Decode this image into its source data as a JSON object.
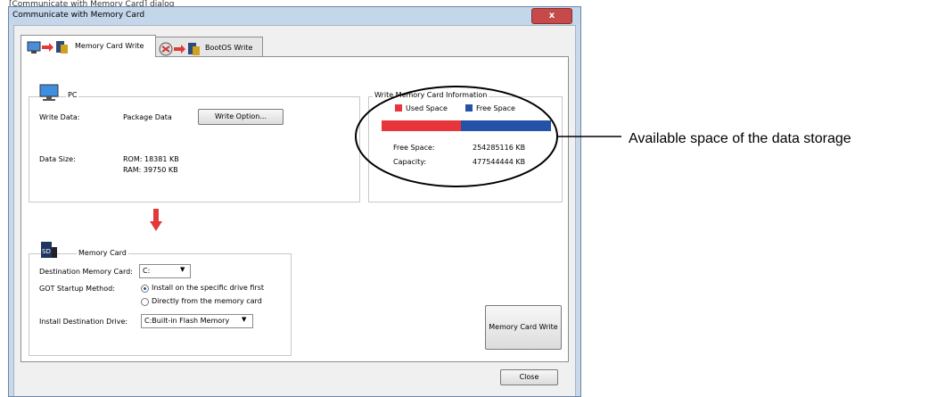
{
  "caption": "[Communicate with Memory Card] dialog",
  "window": {
    "title": "Communicate with Memory Card",
    "close_glyph": "x"
  },
  "tabs": [
    {
      "label": "Memory Card Write",
      "active": true
    },
    {
      "label": "BootOS Write",
      "active": false
    }
  ],
  "pc": {
    "legend": "PC",
    "write_data_label": "Write Data:",
    "write_data_value": "Package Data",
    "write_option_button": "Write Option...",
    "data_size_label": "Data Size:",
    "rom": "ROM: 18381 KB",
    "ram": "RAM: 39750 KB"
  },
  "info": {
    "legend": "Write Memory Card Information",
    "used_legend": "Used Space",
    "free_legend": "Free Space",
    "used_color": "#e8353c",
    "free_color": "#2452a8",
    "used_fraction": 0.4676,
    "free_space_label": "Free Space:",
    "free_space_value": "254285116 KB",
    "capacity_label": "Capacity:",
    "capacity_value": "477544444 KB"
  },
  "memory_card": {
    "legend": "Memory Card",
    "destination_label": "Destination Memory Card:",
    "destination_value": "C:",
    "startup_label": "GOT Startup Method:",
    "startup_options": [
      "Install on the specific drive first",
      "Directly from the memory card"
    ],
    "startup_selected": 0,
    "install_label": "Install Destination Drive:",
    "install_value": "C:Built-in Flash Memory"
  },
  "buttons": {
    "write": "Memory Card Write",
    "close": "Close"
  },
  "annotation": "Available space of the data storage",
  "icons": [
    "pc-icon",
    "arrow-right-icon",
    "memory-card-icon",
    "bootos-icon",
    "down-arrow-icon",
    "sd-card-icon",
    "dropdown-arrow-icon"
  ]
}
